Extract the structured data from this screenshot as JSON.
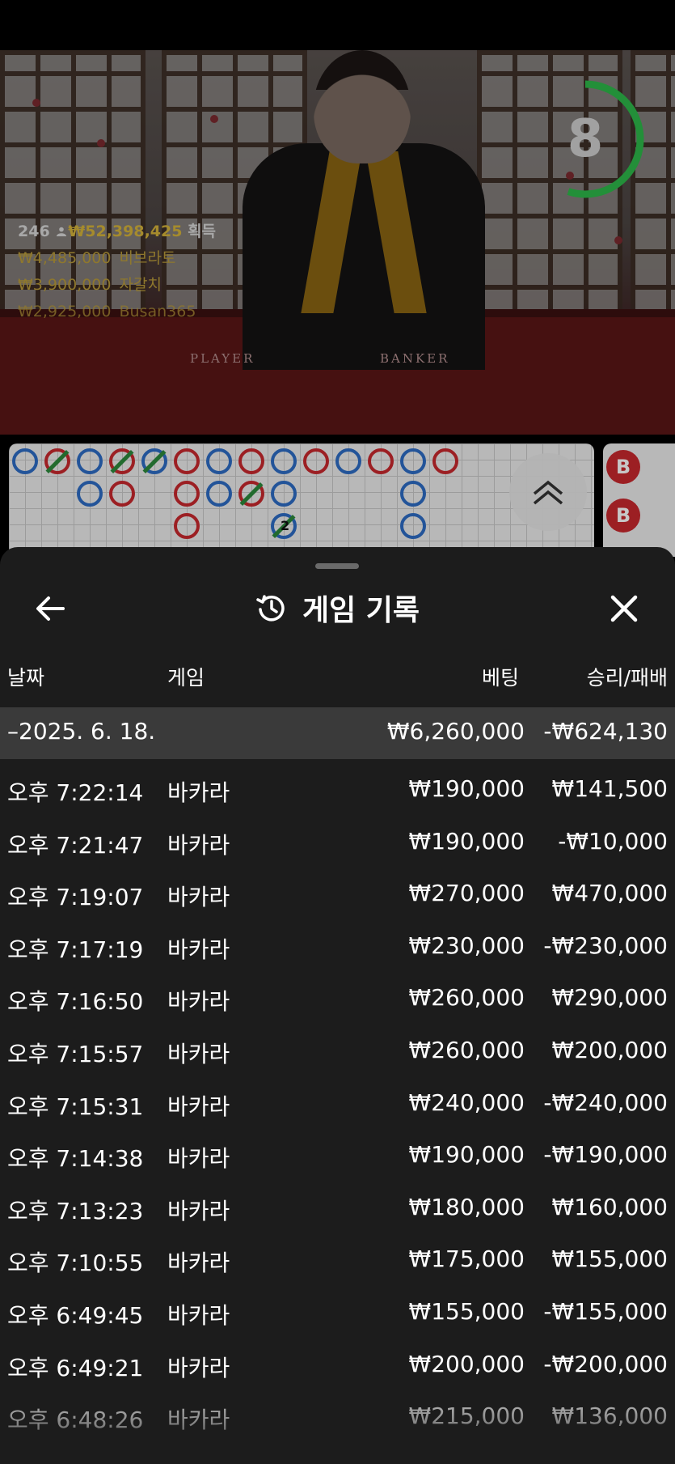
{
  "timer": {
    "value": "8",
    "progress": 0.55,
    "color": "#2db84a"
  },
  "winners": {
    "round": "246",
    "total_amount": "₩52,398,425",
    "total_label": "획득",
    "list": [
      {
        "amount": "₩4,485,000",
        "name": "비브라토"
      },
      {
        "amount": "₩3,900,000",
        "name": "자갈치"
      },
      {
        "amount": "₩2,925,000",
        "name": "Busan365"
      }
    ]
  },
  "table_labels": {
    "player": "PLAYER",
    "banker": "BANKER"
  },
  "bead_road": [
    {
      "label": "B",
      "color": "#c8282e"
    },
    {
      "label": "B",
      "color": "#c8282e"
    }
  ],
  "big_road_number": "2",
  "sheet": {
    "title": "게임 기록",
    "columns": {
      "date": "날짜",
      "game": "게임",
      "bet": "베팅",
      "win_loss": "승리/패배"
    },
    "summary": {
      "date": "–2025. 6. 18.",
      "bet": "₩6,260,000",
      "win_loss": "-₩624,130"
    },
    "rows": [
      {
        "time": "오후 7:22:14",
        "game": "바카라",
        "bet": "₩190,000",
        "win_loss": "₩141,500"
      },
      {
        "time": "오후 7:21:47",
        "game": "바카라",
        "bet": "₩190,000",
        "win_loss": "-₩10,000"
      },
      {
        "time": "오후 7:19:07",
        "game": "바카라",
        "bet": "₩270,000",
        "win_loss": "₩470,000"
      },
      {
        "time": "오후 7:17:19",
        "game": "바카라",
        "bet": "₩230,000",
        "win_loss": "-₩230,000"
      },
      {
        "time": "오후 7:16:50",
        "game": "바카라",
        "bet": "₩260,000",
        "win_loss": "₩290,000"
      },
      {
        "time": "오후 7:15:57",
        "game": "바카라",
        "bet": "₩260,000",
        "win_loss": "₩200,000"
      },
      {
        "time": "오후 7:15:31",
        "game": "바카라",
        "bet": "₩240,000",
        "win_loss": "-₩240,000"
      },
      {
        "time": "오후 7:14:38",
        "game": "바카라",
        "bet": "₩190,000",
        "win_loss": "-₩190,000"
      },
      {
        "time": "오후 7:13:23",
        "game": "바카라",
        "bet": "₩180,000",
        "win_loss": "₩160,000"
      },
      {
        "time": "오후 7:10:55",
        "game": "바카라",
        "bet": "₩175,000",
        "win_loss": "₩155,000"
      },
      {
        "time": "오후 6:49:45",
        "game": "바카라",
        "bet": "₩155,000",
        "win_loss": "-₩155,000"
      },
      {
        "time": "오후 6:49:21",
        "game": "바카라",
        "bet": "₩200,000",
        "win_loss": "-₩200,000"
      },
      {
        "time": "오후 6:48:26",
        "game": "바카라",
        "bet": "₩215,000",
        "win_loss": "₩136,000"
      }
    ]
  },
  "icons": {
    "back": "arrow-left-icon",
    "history": "history-icon",
    "close": "close-icon",
    "expand": "double-chevron-up-icon",
    "person": "person-icon"
  }
}
